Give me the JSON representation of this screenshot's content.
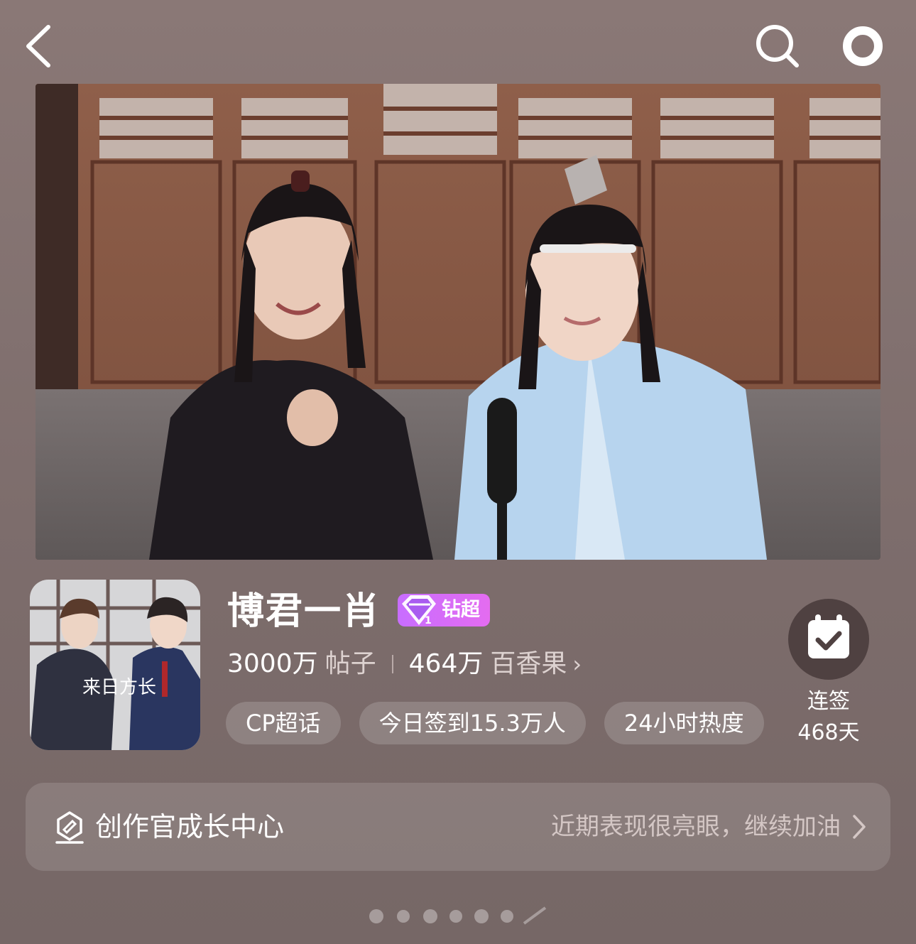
{
  "header": {
    "back_icon": "chevron-left-icon",
    "search_icon": "search-icon",
    "more_icon": "ring-icon"
  },
  "topic": {
    "title": "博君一肖",
    "badge_label": "钻超",
    "badge_color": "#d86cf6",
    "posts_count": "3000万",
    "posts_label": "帖子",
    "fans_count": "464万",
    "fans_label": "百香果",
    "fans_chevron": "›"
  },
  "chips": [
    "CP超话",
    "今日签到15.3万人",
    "24小时热度"
  ],
  "checkin": {
    "label": "连签",
    "days": "468天",
    "icon": "calendar-check-icon"
  },
  "growth": {
    "title": "创作官成长中心",
    "subtitle": "近期表现很亮眼，继续加油",
    "icon": "creator-badge-icon"
  },
  "avatar": {
    "caption": "来日方长"
  }
}
